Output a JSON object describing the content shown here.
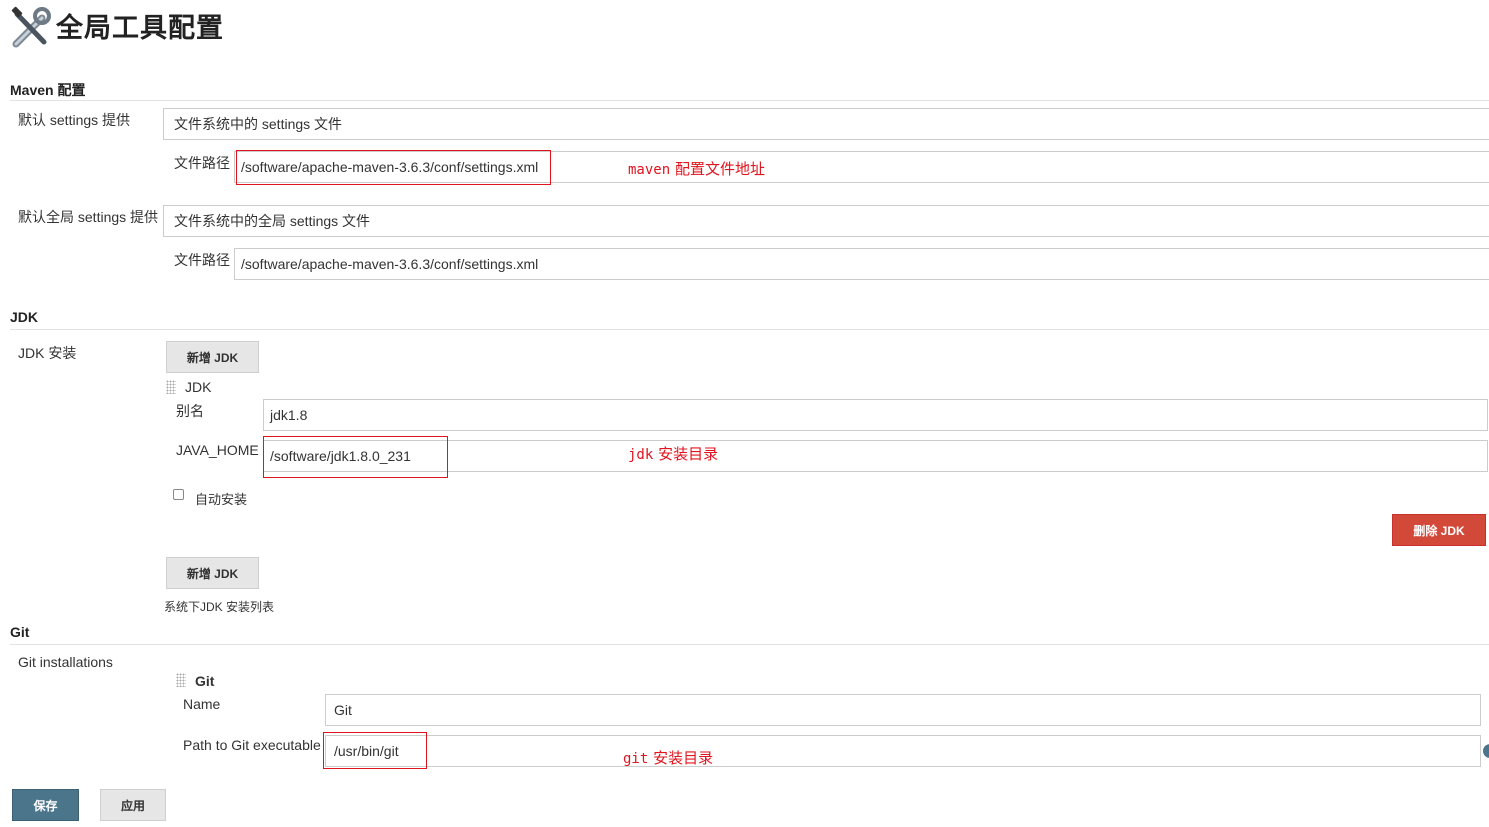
{
  "page": {
    "title": "全局工具配置",
    "title_icon": "tools-icon"
  },
  "maven": {
    "section_title": "Maven 配置",
    "default_settings": {
      "label": "默认 settings 提供",
      "selected": "文件系统中的 settings 文件",
      "path_label": "文件路径",
      "path_value": "/software/apache-maven-3.6.3/conf/settings.xml"
    },
    "global_settings": {
      "label": "默认全局 settings 提供",
      "selected": "文件系统中的全局 settings 文件",
      "path_label": "文件路径",
      "path_value": "/software/apache-maven-3.6.3/conf/settings.xml"
    },
    "annotation_code": "maven",
    "annotation_text": "配置文件地址"
  },
  "jdk": {
    "section_title": "JDK",
    "install_label": "JDK 安装",
    "add_button": "新增 JDK",
    "item_title": "JDK",
    "alias_label": "别名",
    "alias_value": "jdk1.8",
    "java_home_label": "JAVA_HOME",
    "java_home_value": "/software/jdk1.8.0_231",
    "auto_install_label": "自动安装",
    "auto_install_checked": false,
    "delete_button": "删除 JDK",
    "add_button_2": "新增 JDK",
    "list_caption": "系统下JDK 安装列表",
    "annotation_code": "jdk",
    "annotation_text": "安装目录"
  },
  "git": {
    "section_title": "Git",
    "installations_label": "Git installations",
    "item_title": "Git",
    "name_label": "Name",
    "name_value": "Git",
    "path_label": "Path to Git executable",
    "path_value": "/usr/bin/git",
    "annotation_code": "git",
    "annotation_text": "安装目录"
  },
  "footer": {
    "save_button": "保存",
    "apply_button": "应用"
  },
  "colors": {
    "primary": "#4b758b",
    "danger": "#d24939",
    "annotation": "#e0141e"
  }
}
